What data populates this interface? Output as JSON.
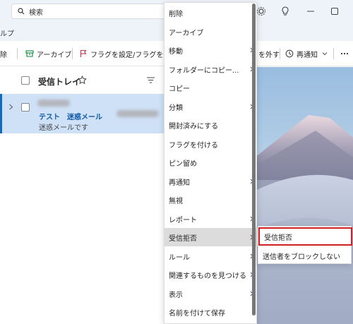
{
  "search": {
    "placeholder": "検索"
  },
  "tabs": {
    "help_partial": "ルプ"
  },
  "ribbon": {
    "delete_partial": "除",
    "archive": "アーカイブ",
    "flag": "フラグを設定/フラグを解除",
    "unflag_partial": "を外す",
    "snooze": "再通知"
  },
  "inbox": {
    "title": "受信トレイ",
    "item": {
      "subject": "テスト　迷惑メール",
      "preview": "迷惑メールです"
    }
  },
  "context_menu": {
    "items": [
      {
        "label": "削除"
      },
      {
        "label": "アーカイブ"
      },
      {
        "label": "移動"
      },
      {
        "label": "フォルダーにコピー..."
      },
      {
        "label": "コピー"
      },
      {
        "label": "分類"
      },
      {
        "label": "開封済みにする"
      },
      {
        "label": "フラグを付ける"
      },
      {
        "label": "ピン留め"
      },
      {
        "label": "再通知"
      },
      {
        "label": "無視"
      },
      {
        "label": "レポート"
      },
      {
        "label": "受信拒否"
      },
      {
        "label": "ルール"
      },
      {
        "label": "関連するものを見つける"
      },
      {
        "label": "表示"
      },
      {
        "label": "名前を付けて保存"
      }
    ]
  },
  "submenu": {
    "items": [
      {
        "label": "受信拒否"
      },
      {
        "label": "送信者をブロックしない"
      }
    ]
  },
  "colors": {
    "accent": "#0f6cbd",
    "highlight_border": "#d21f26",
    "selected_item": "#cfe1f7"
  }
}
